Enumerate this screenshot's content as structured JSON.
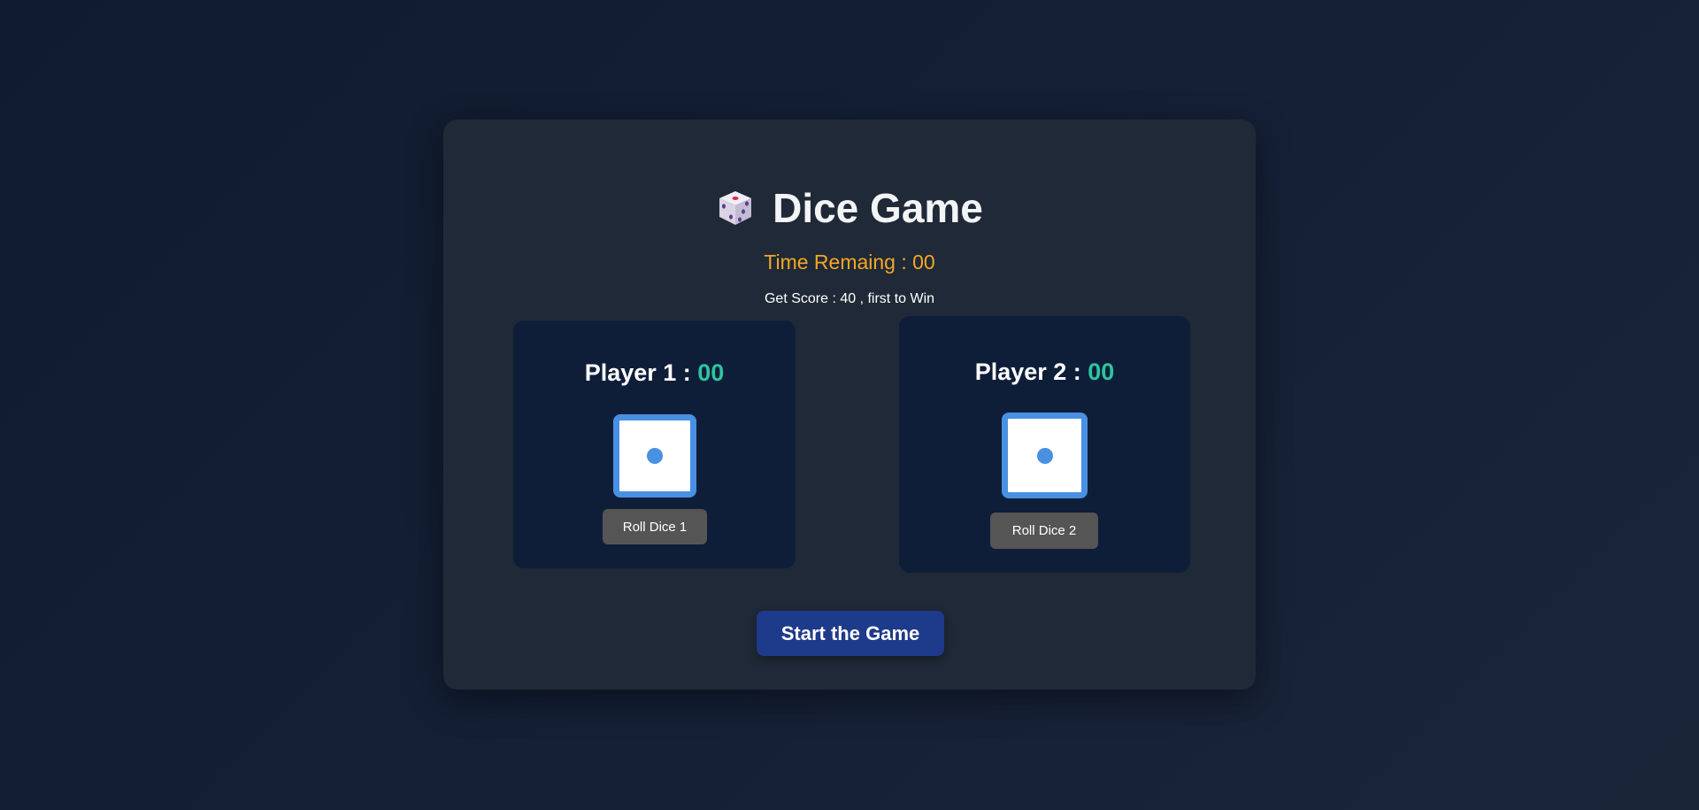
{
  "game": {
    "title": "Dice Game",
    "title_icon": "game-die-icon",
    "timer_text": "Time Remaing : 00",
    "goal_text": "Get Score : 40 , first to Win",
    "start_label": "Start the Game"
  },
  "players": [
    {
      "label": "Player 1 : ",
      "score": "00",
      "die_face": 1,
      "roll_label": "Roll Dice 1"
    },
    {
      "label": "Player 2 : ",
      "score": "00",
      "die_face": 1,
      "roll_label": "Roll Dice 2"
    }
  ],
  "colors": {
    "background": "#111c2e",
    "card": "#1f2937",
    "panel": "#0f1e38",
    "timer": "#f5a623",
    "score": "#2ec4a0",
    "die_border": "#4a90e2",
    "roll_button": "#555555",
    "start_button": "#1e3a8a"
  }
}
